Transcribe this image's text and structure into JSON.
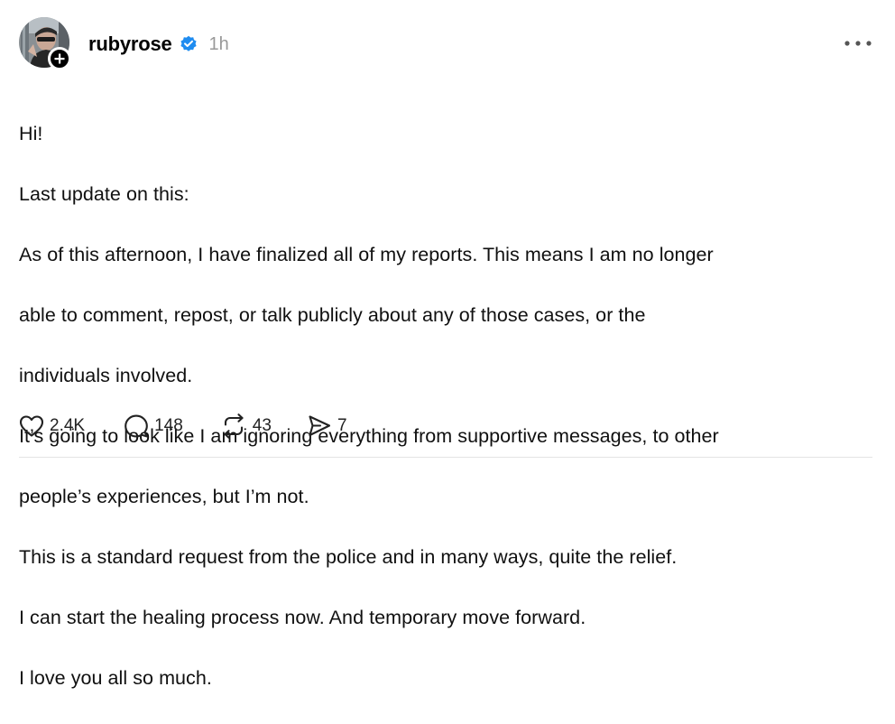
{
  "post": {
    "author": {
      "username": "rubyrose",
      "verified": true,
      "verified_color": "#1f8cf0",
      "avatar_icon": "avatar-photo",
      "follow_icon": "plus-icon"
    },
    "timestamp": "1h",
    "more_icon": "more-dots-icon",
    "body_lines": [
      "Hi!",
      "Last update on this:",
      "As of this afternoon, I have finalized all of my reports. This means I am no longer",
      "able to comment, repost, or talk publicly about any of those cases, or the",
      "individuals involved.",
      "It’s going to look like I am ignoring everything from supportive messages, to other",
      "people’s experiences, but I’m not.",
      "This is a standard request from the police and in many ways, quite the relief.",
      "I can start the healing process now. And temporary move forward.",
      "I love you all so much."
    ],
    "actions": {
      "likes": {
        "icon": "heart-icon",
        "count": "2.4K"
      },
      "comments": {
        "icon": "comment-icon",
        "count": "148"
      },
      "reposts": {
        "icon": "repost-icon",
        "count": "43"
      },
      "shares": {
        "icon": "share-icon",
        "count": "7"
      }
    }
  }
}
